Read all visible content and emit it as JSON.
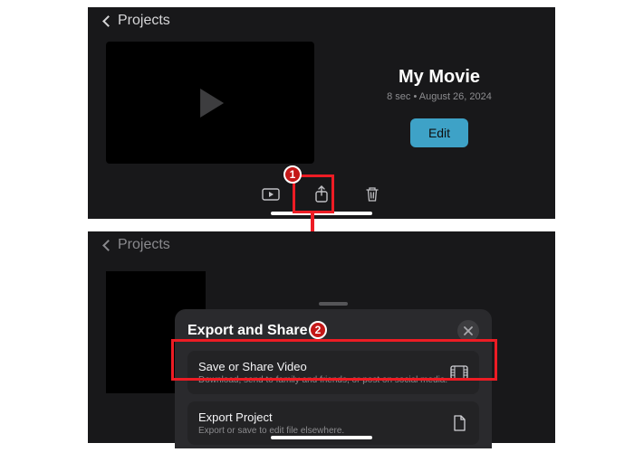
{
  "nav": {
    "back_label": "Projects"
  },
  "project": {
    "title": "My Movie",
    "meta": "8 sec • August 26, 2024",
    "edit_label": "Edit"
  },
  "sheet": {
    "title": "Export and Share",
    "items": [
      {
        "title": "Save or Share Video",
        "sub": "Download, send to family and friends, or post on social media."
      },
      {
        "title": "Export Project",
        "sub": "Export or save to edit file elsewhere."
      }
    ]
  },
  "badges": {
    "one": "1",
    "two": "2"
  }
}
